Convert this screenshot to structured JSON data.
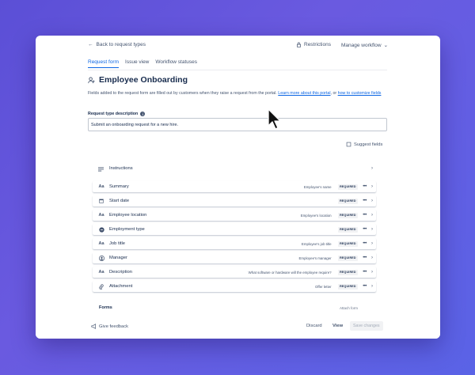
{
  "topbar": {
    "back_label": "Back to request types",
    "restrictions_label": "Restrictions",
    "manage_workflow_label": "Manage workflow"
  },
  "tabs": [
    {
      "label": "Request form",
      "active": true
    },
    {
      "label": "Issue view",
      "active": false
    },
    {
      "label": "Workflow statuses",
      "active": false
    }
  ],
  "page": {
    "title": "Employee Onboarding",
    "description_text": "Fields added to the request form are filled out by customers when they raise a request from the portal.",
    "learn_more_link": "Learn more about this portal",
    "description_or": ", or",
    "customize_link": "how to customize fields"
  },
  "request_type_description": {
    "label": "Request type description",
    "value": "Submit an onboarding request for a new hire."
  },
  "suggest_fields_label": "Suggest fields",
  "instructions_label": "Instructions",
  "fields": [
    {
      "icon": "text-icon",
      "name": "Summary",
      "hint": "Employee's name",
      "required": "REQUIRED"
    },
    {
      "icon": "calendar-icon",
      "name": "Start date",
      "hint": "",
      "required": "REQUIRED"
    },
    {
      "icon": "text-icon",
      "name": "Employee location",
      "hint": "Employee's location",
      "required": "REQUIRED"
    },
    {
      "icon": "select-icon",
      "name": "Employment type",
      "hint": "",
      "required": "REQUIRED"
    },
    {
      "icon": "text-icon",
      "name": "Job title",
      "hint": "Employee's job title",
      "required": "REQUIRED"
    },
    {
      "icon": "user-icon",
      "name": "Manager",
      "hint": "Employee's manager",
      "required": "REQUIRED"
    },
    {
      "icon": "text-icon",
      "name": "Description",
      "hint": "What software or hardware will the employee require?",
      "required": "REQUIRED"
    },
    {
      "icon": "attachment-icon",
      "name": "Attachment",
      "hint": "Offer letter",
      "required": "REQUIRED"
    }
  ],
  "forms_label": "Forms",
  "attach_form_label": "Attach form",
  "footer": {
    "feedback_label": "Give feedback",
    "discard_label": "Discard",
    "view_label": "View",
    "save_label": "Save changes"
  },
  "colors": {
    "background": "#5b4fd6",
    "accent": "#0c66e4"
  }
}
